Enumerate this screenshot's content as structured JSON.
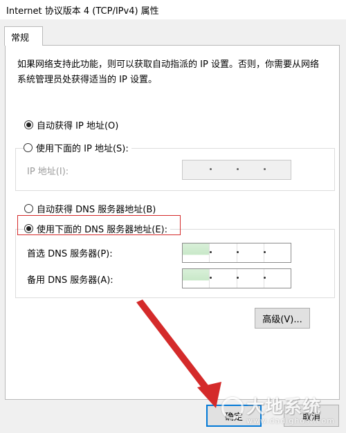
{
  "window": {
    "title": "Internet 协议版本 4 (TCP/IPv4) 属性"
  },
  "tabs": [
    {
      "label": "常规"
    }
  ],
  "description": "如果网络支持此功能，则可以获取自动指派的 IP 设置。否则，你需要从网络系统管理员处获得适当的 IP 设置。",
  "ip_section": {
    "auto_radio": {
      "label": "自动获得 IP 地址(O)",
      "checked": true
    },
    "manual_radio": {
      "label": "使用下面的 IP 地址(S):",
      "checked": false
    },
    "ip_address": {
      "label": "IP 地址(I):",
      "enabled": false,
      "segments": [
        "",
        "",
        "",
        ""
      ]
    }
  },
  "dns_section": {
    "auto_radio": {
      "label": "自动获得 DNS 服务器地址(B)",
      "checked": false
    },
    "manual_radio": {
      "label": "使用下面的 DNS 服务器地址(E):",
      "checked": true
    },
    "preferred": {
      "label": "首选 DNS 服务器(P):",
      "segments": [
        "",
        "",
        "",
        ""
      ]
    },
    "alternate": {
      "label": "备用 DNS 服务器(A):",
      "segments": [
        "",
        "",
        "",
        ""
      ]
    }
  },
  "buttons": {
    "advanced": "高级(V)...",
    "ok": "确定",
    "cancel": "取消"
  },
  "watermark": {
    "text": "大地系统",
    "subtext": "www.dadighost.com"
  },
  "colors": {
    "highlight_box": "#d42a2a",
    "arrow": "#d42a2a"
  }
}
